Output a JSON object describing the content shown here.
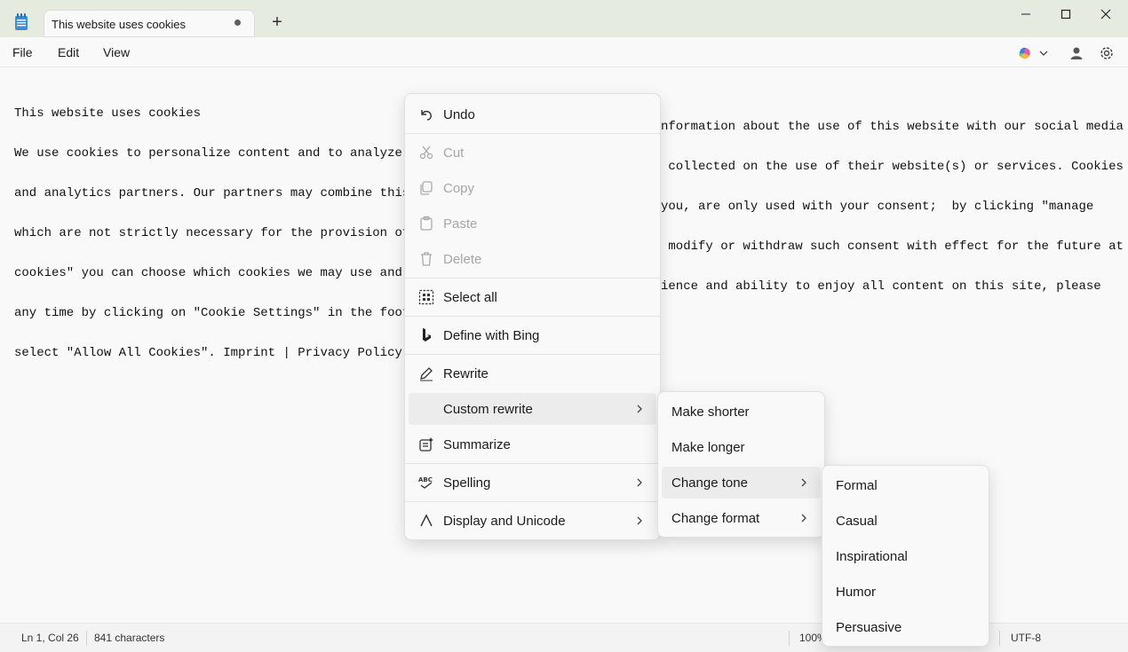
{
  "window": {
    "tab_title": "This website uses cookies",
    "new_tab": "+"
  },
  "menubar": {
    "file": "File",
    "edit": "Edit",
    "view": "View"
  },
  "editor": {
    "lines": [
      "This website uses cookies",
      "We use cookies to personalize content and to analyze th",
      "and analytics partners. Our partners may combine this i",
      "which are not strictly necessary for the provision of o",
      "cookies\" you can choose which cookies we may use and fo",
      "any time by clicking on \"Cookie Settings\" in the footer",
      "select \"Allow All Cookies\". Imprint | Privacy Policy"
    ],
    "right_lines": [
      "nformation about the use of this website with our social media",
      " collected on the use of their website(s) or services. Cookies",
      "you, are only used with your consent;  by clicking \"manage",
      " modify or withdraw such consent with effect for the future at",
      "ience and ability to enjoy all content on this site, please"
    ]
  },
  "context_menu": {
    "undo": "Undo",
    "cut": "Cut",
    "copy": "Copy",
    "paste": "Paste",
    "delete": "Delete",
    "select_all": "Select all",
    "define_bing": "Define with Bing",
    "rewrite": "Rewrite",
    "custom_rewrite": "Custom rewrite",
    "summarize": "Summarize",
    "spelling": "Spelling",
    "display_unicode": "Display and Unicode"
  },
  "rewrite_submenu": {
    "make_shorter": "Make shorter",
    "make_longer": "Make longer",
    "change_tone": "Change tone",
    "change_format": "Change format"
  },
  "tone_submenu": [
    "Formal",
    "Casual",
    "Inspirational",
    "Humor",
    "Persuasive"
  ],
  "statusbar": {
    "position": "Ln 1, Col 26",
    "characters": "841 characters",
    "zoom": "100%",
    "encoding": "UTF-8"
  }
}
